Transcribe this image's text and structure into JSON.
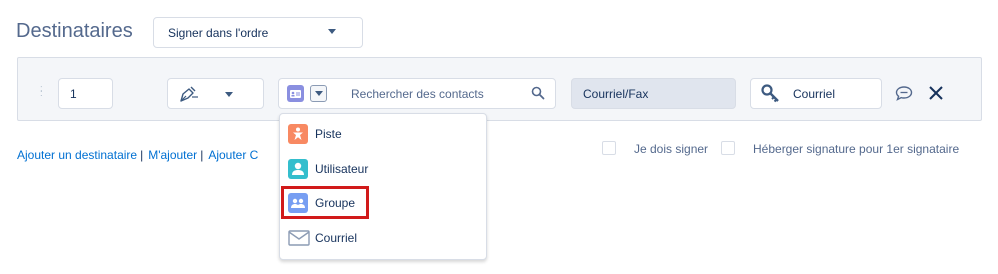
{
  "header": {
    "title": "Destinataires",
    "signing_order": "Signer dans l'ordre"
  },
  "recipient": {
    "order": "1",
    "action_icon": "pen-nib-icon",
    "search": {
      "placeholder": "Rechercher des contacts"
    },
    "delivery": "Courriel/Fax",
    "auth_method": "Courriel"
  },
  "links": {
    "add_recipient": "Ajouter un destinataire",
    "add_me": "M'ajouter",
    "add_other": "Ajouter C"
  },
  "options": {
    "i_must_sign": "Je dois signer",
    "host_signature": "Héberger signature pour 1er signataire"
  },
  "dropdown": {
    "items": [
      {
        "label": "Piste",
        "icon": "lead-icon",
        "color": "#f88962"
      },
      {
        "label": "Utilisateur",
        "icon": "user-icon",
        "color": "#34becd"
      },
      {
        "label": "Groupe",
        "icon": "group-icon",
        "color": "#779ef2"
      },
      {
        "label": "Courriel",
        "icon": "email-icon",
        "color": "#8b9bb4"
      }
    ],
    "highlighted": "Groupe",
    "highlight_color": "#d11a1a"
  }
}
